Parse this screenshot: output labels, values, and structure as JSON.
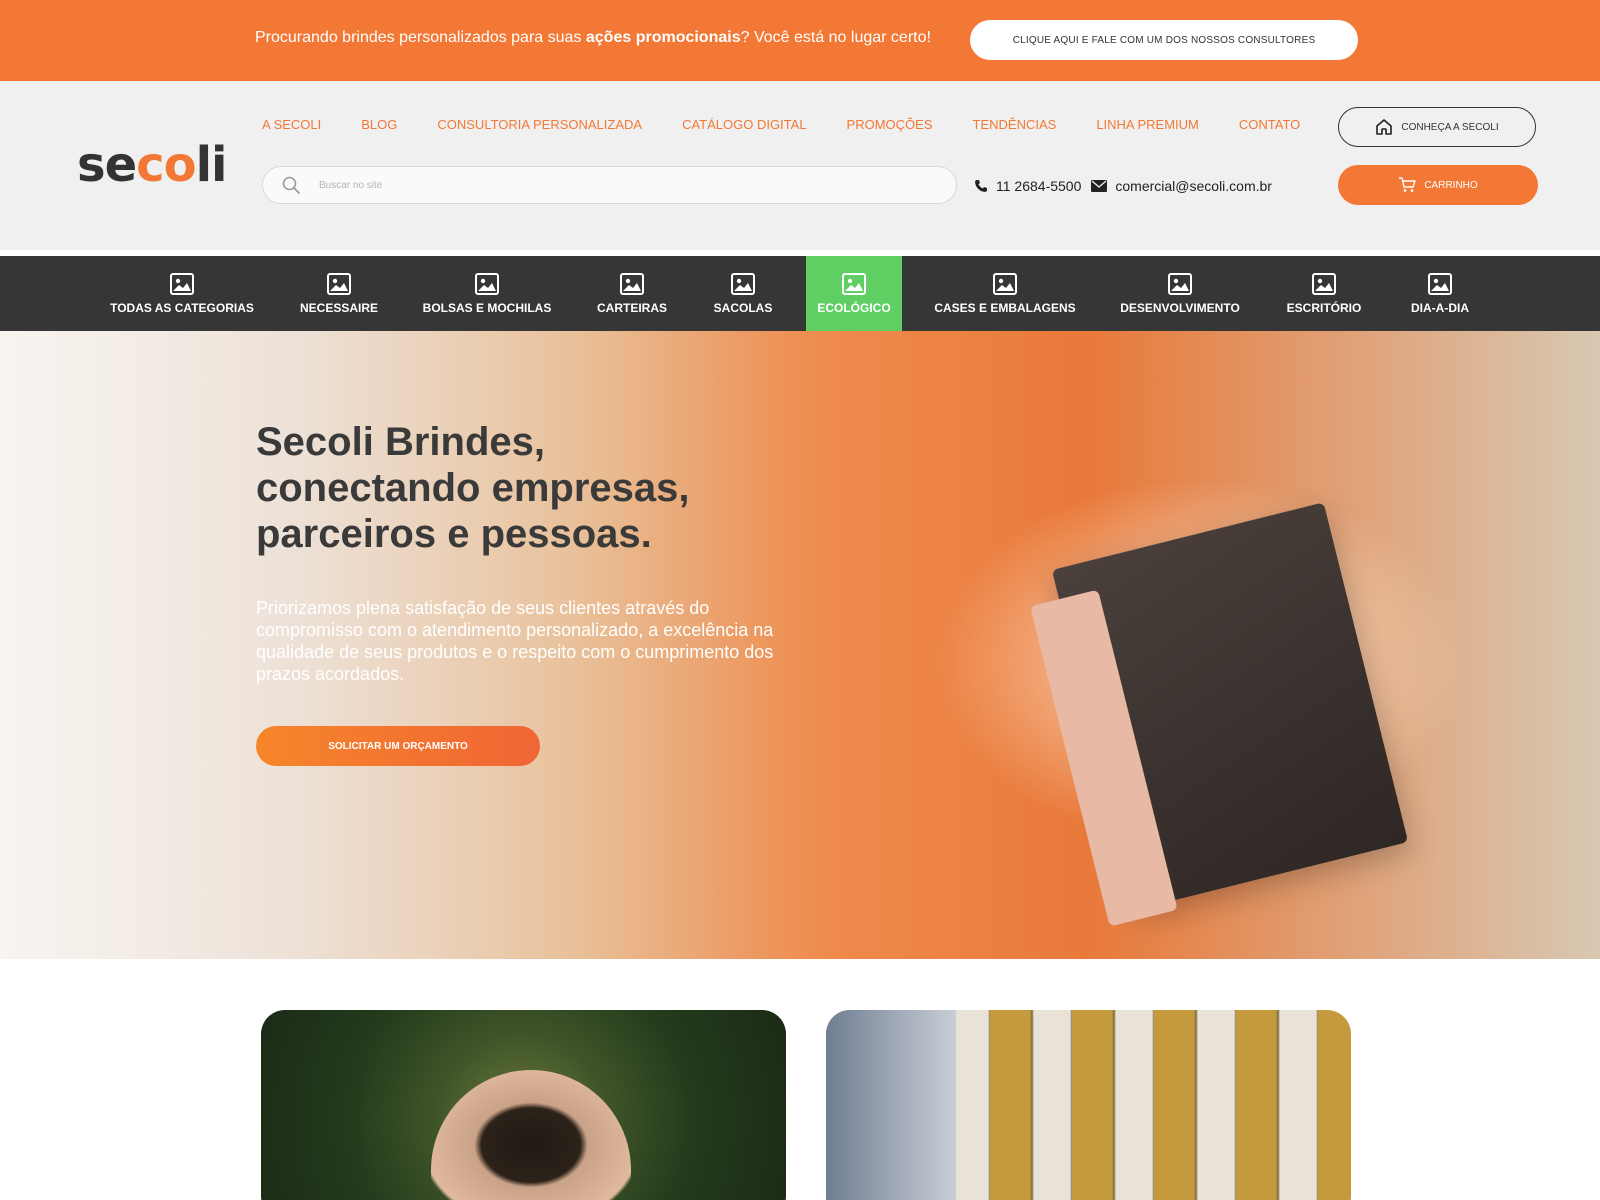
{
  "promo": {
    "text_prefix": "Procurando brindes personalizados para suas ",
    "text_bold": "ações promocionais",
    "text_suffix": "? Você está no lugar certo!",
    "cta_label": "CLIQUE AQUI E FALE COM UM DOS NOSSOS CONSULTORES"
  },
  "logo": {
    "part1": "se",
    "part2": "co",
    "part3": "li"
  },
  "nav": [
    "A SECOLI",
    "BLOG",
    "CONSULTORIA PERSONALIZADA",
    "CATÁLOGO DIGITAL",
    "PROMOÇÕES",
    "TENDÊNCIAS",
    "LINHA PREMIUM",
    "CONTATO"
  ],
  "search": {
    "placeholder": "Buscar no site"
  },
  "contact": {
    "phone": "11 2684-5500",
    "email": "comercial@secoli.com.br"
  },
  "buttons": {
    "about": "CONHEÇA A SECOLI",
    "cart": "CARRINHO"
  },
  "categories": {
    "active": "ECOLÓGICO",
    "items": [
      "TODAS AS CATEGORIAS",
      "NECESSAIRE",
      "BOLSAS E MOCHILAS",
      "CARTEIRAS",
      "SACOLAS",
      "ECOLÓGICO",
      "CASES E EMBALAGENS",
      "DESENVOLVIMENTO",
      "ESCRITÓRIO",
      "DIA-A-DIA"
    ]
  },
  "hero": {
    "title_lines": [
      "Secoli Brindes,",
      "conectando empresas,",
      "parceiros e pessoas."
    ],
    "description": "Priorizamos plena satisfação de seus clientes através do compromisso com o atendimento personalizado, a excelência na qualidade de seus produtos e o respeito com o cumprimento dos prazos acordados.",
    "cta": "SOLICITAR UM ORÇAMENTO"
  },
  "colors": {
    "brand_orange": "#f37835",
    "category_bar": "#363636",
    "category_active": "#5fcf64",
    "header_bg": "#f0f0f0"
  },
  "icons": {
    "category": "image-icon",
    "phone": "phone-icon",
    "email": "envelope-icon",
    "about": "home-icon",
    "cart": "cart-icon",
    "search": "search-icon"
  }
}
